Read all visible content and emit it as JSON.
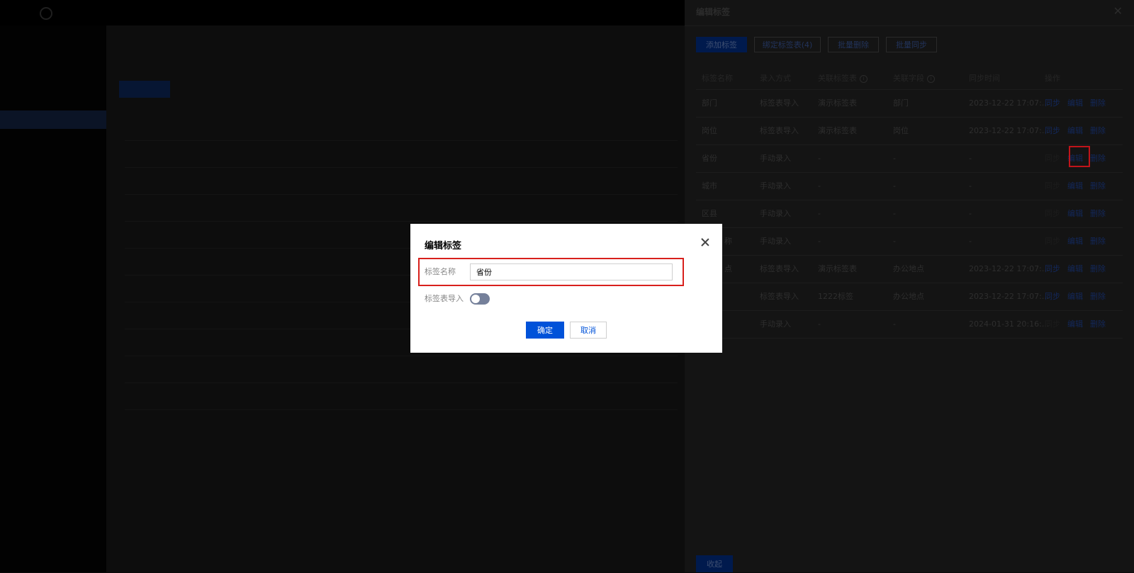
{
  "drawer": {
    "title": "编辑标签",
    "buttons": {
      "add": "添加标签",
      "bind": "绑定标签表(4)",
      "batch_delete": "批量删除",
      "batch_sync": "批量同步"
    },
    "columns": [
      "标签名称",
      "录入方式",
      "关联标签表",
      "关联字段",
      "同步时间",
      "操作"
    ],
    "rows": [
      {
        "name": "部门",
        "method": "标签表导入",
        "table": "演示标签表",
        "field": "部门",
        "time": "2023-12-22 17:07:..."
      },
      {
        "name": "岗位",
        "method": "标签表导入",
        "table": "演示标签表",
        "field": "岗位",
        "time": "2023-12-22 17:07:..."
      },
      {
        "name": "省份",
        "method": "手动录入",
        "table": "-",
        "field": "-",
        "time": "-"
      },
      {
        "name": "城市",
        "method": "手动录入",
        "table": "-",
        "field": "-",
        "time": "-"
      },
      {
        "name": "区县",
        "method": "手动录入",
        "table": "-",
        "field": "-",
        "time": "-"
      },
      {
        "name": "称",
        "method": "手动录入",
        "table": "-",
        "field": "-",
        "time": "-"
      },
      {
        "name": "点",
        "method": "标签表导入",
        "table": "演示标签表",
        "field": "办公地点",
        "time": "2023-12-22 17:07:..."
      },
      {
        "name": "",
        "method": "标签表导入",
        "table": "1222标签",
        "field": "办公地点",
        "time": "2023-12-22 17:07:..."
      },
      {
        "name": "",
        "method": "手动录入",
        "table": "-",
        "field": "-",
        "time": "2024-01-31 20:16:..."
      }
    ],
    "actions": {
      "sync": "同步",
      "edit": "编辑",
      "delete": "删除"
    },
    "footer_button": "收起"
  },
  "modal": {
    "title": "编辑标签",
    "name_label": "标签名称",
    "name_value": "省份",
    "toggle_label": "标签表导入",
    "ok": "确定",
    "cancel": "取消"
  },
  "colors": {
    "primary": "#0052d9",
    "highlight": "#d8201c"
  }
}
